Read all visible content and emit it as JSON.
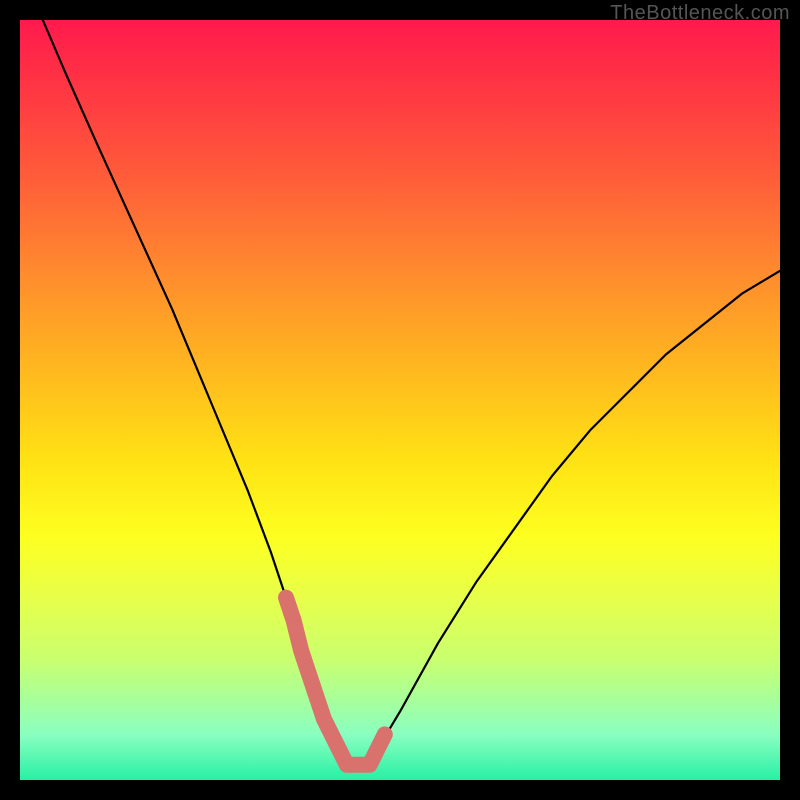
{
  "watermark": "TheBottleneck.com",
  "chart_data": {
    "type": "line",
    "title": "",
    "xlabel": "",
    "ylabel": "",
    "xlim": [
      0,
      100
    ],
    "ylim": [
      0,
      100
    ],
    "series": [
      {
        "name": "bottleneck-curve",
        "x": [
          3,
          6,
          10,
          15,
          20,
          25,
          30,
          33,
          35,
          37,
          40,
          42,
          44,
          46,
          47,
          50,
          55,
          60,
          65,
          70,
          75,
          80,
          85,
          90,
          95,
          100
        ],
        "values": [
          100,
          93,
          84,
          73,
          62,
          50,
          38,
          30,
          24,
          17,
          8,
          4,
          2,
          2,
          4,
          9,
          18,
          26,
          33,
          40,
          46,
          51,
          56,
          60,
          64,
          67
        ]
      }
    ],
    "highlight": {
      "name": "optimal-zone",
      "color": "#d9716d",
      "x": [
        35,
        36,
        37,
        38,
        39,
        40,
        41,
        42,
        43,
        44,
        45,
        46,
        47,
        48
      ],
      "values": [
        24,
        21,
        17,
        14,
        11,
        8,
        6,
        4,
        2,
        2,
        2,
        2,
        4,
        6
      ]
    }
  }
}
